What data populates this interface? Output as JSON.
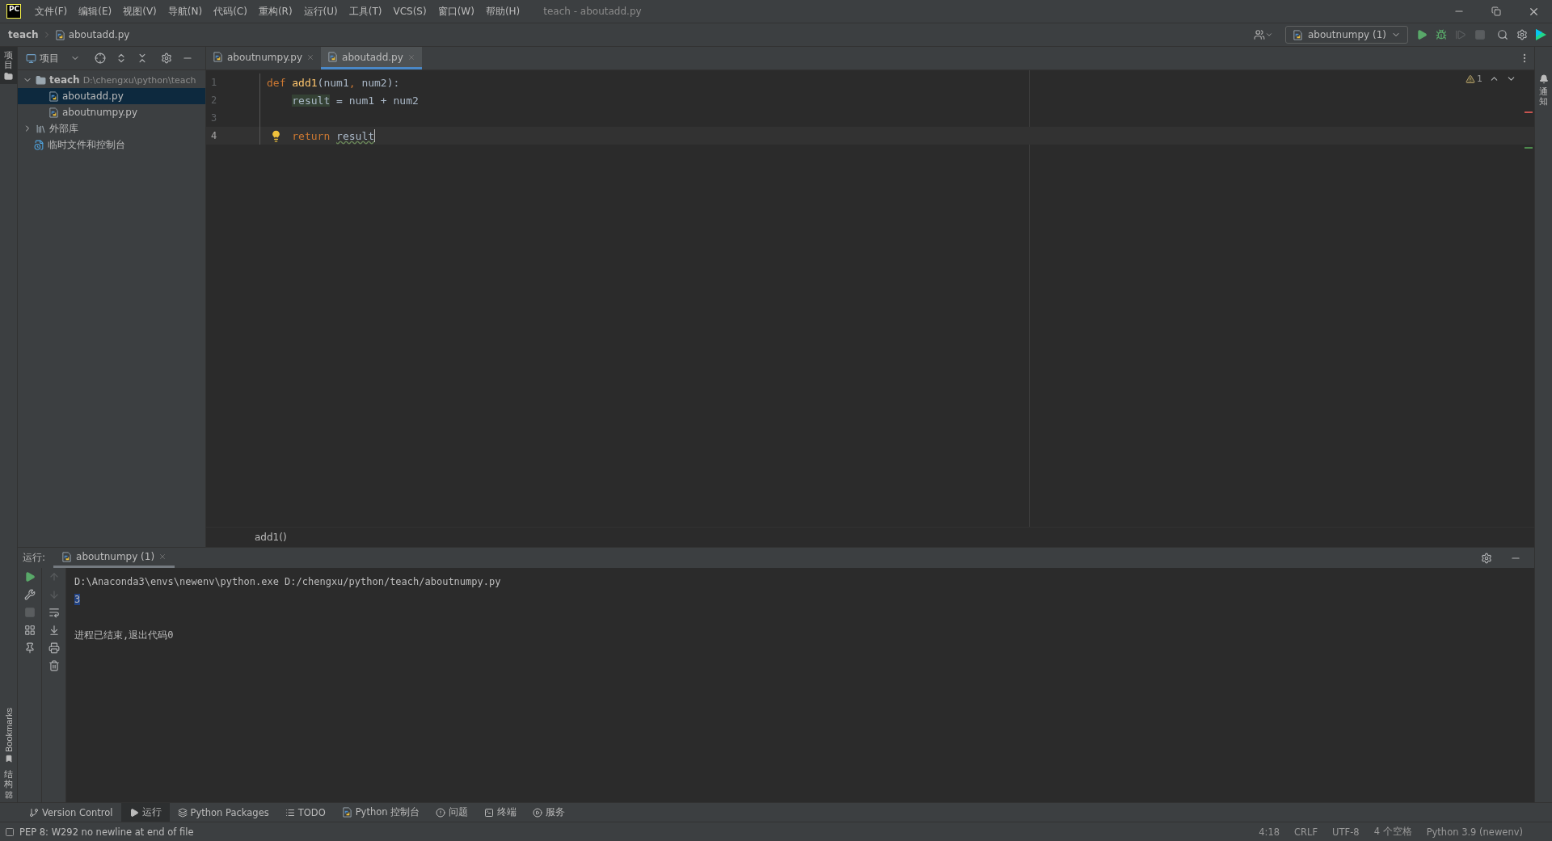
{
  "title_bar": {
    "logo": "PC",
    "menu": [
      "文件(F)",
      "编辑(E)",
      "视图(V)",
      "导航(N)",
      "代码(C)",
      "重构(R)",
      "运行(U)",
      "工具(T)",
      "VCS(S)",
      "窗口(W)",
      "帮助(H)"
    ],
    "title": "teach - aboutadd.py"
  },
  "nav_bar": {
    "breadcrumbs": [
      "teach",
      "aboutadd.py"
    ],
    "run_config": "aboutnumpy (1)"
  },
  "left_strip": {
    "top": "项目",
    "bookmarks": "Bookmarks",
    "structure": "结构"
  },
  "right_strip": {
    "label": "通知"
  },
  "project": {
    "header": "项目",
    "tree": [
      {
        "label": "teach",
        "path": "D:\\chengxu\\python\\teach",
        "kind": "folder",
        "expanded": true,
        "selected": false,
        "children": [
          {
            "label": "aboutadd.py",
            "kind": "file",
            "selected": true
          },
          {
            "label": "aboutnumpy.py",
            "kind": "file",
            "selected": false
          }
        ]
      },
      {
        "label": "外部库",
        "kind": "library",
        "expanded": false,
        "selected": false
      },
      {
        "label": "临时文件和控制台",
        "kind": "scratch",
        "selected": false
      }
    ]
  },
  "editor": {
    "tabs": [
      {
        "label": "aboutnumpy.py",
        "selected": false
      },
      {
        "label": "aboutadd.py",
        "selected": true
      }
    ],
    "warnings": "1",
    "lines": [
      {
        "number": "1",
        "current": false,
        "indented": false,
        "tokens": [
          {
            "kind": "keyword",
            "text": "def",
            "space_before": false
          },
          {
            "kind": "function",
            "text": "add1",
            "space_before": true
          },
          {
            "kind": "plain",
            "text": "(num1",
            "space_before": false
          },
          {
            "kind": "keyword",
            "text": ",",
            "space_before": false
          },
          {
            "kind": "plain",
            "text": "num2):",
            "space_before": true
          }
        ]
      },
      {
        "number": "2",
        "current": false,
        "indented": true,
        "tokens": [
          {
            "kind": "usage",
            "text": "result",
            "space_before": false
          },
          {
            "kind": "plain",
            "text": "= num1 + num2",
            "space_before": true
          }
        ]
      },
      {
        "number": "3",
        "current": false
      },
      {
        "number": "4",
        "current": true,
        "indented": true,
        "caret": true,
        "bulb": true,
        "tokens": [
          {
            "kind": "keyword",
            "text": "return",
            "space_before": false
          },
          {
            "kind": "warning",
            "text": "result",
            "space_before": true
          }
        ]
      }
    ],
    "breadcrumb": "add1()"
  },
  "run": {
    "label": "运行:",
    "tabs": [
      {
        "label": "aboutnumpy (1)",
        "selected": true
      }
    ],
    "output": [
      {
        "kind": "text",
        "text": "D:\\Anaconda3\\envs\\newenv\\python.exe D:/chengxu/python/teach/aboutnumpy.py"
      },
      {
        "kind": "selected",
        "text": "3"
      },
      {
        "kind": "blank"
      },
      {
        "kind": "text",
        "text": "进程已结束,退出代码0"
      }
    ]
  },
  "bottom_tools": [
    {
      "kind": "branch",
      "label": "Version Control",
      "selected": false
    },
    {
      "kind": "play",
      "label": "运行",
      "selected": true
    },
    {
      "kind": "layers",
      "label": "Python Packages",
      "selected": false
    },
    {
      "kind": "list",
      "label": "TODO",
      "selected": false
    },
    {
      "kind": "python",
      "label": "Python 控制台",
      "selected": false
    },
    {
      "kind": "alert",
      "label": "问题",
      "selected": false
    },
    {
      "kind": "terminal",
      "label": "终端",
      "selected": false
    },
    {
      "kind": "service",
      "label": "服务",
      "selected": false
    }
  ],
  "status_bar": {
    "message": "PEP 8: W292 no newline at end of file",
    "items": [
      "4:18",
      "CRLF",
      "UTF-8",
      "4 个空格",
      "Python 3.9 (newenv)"
    ]
  }
}
